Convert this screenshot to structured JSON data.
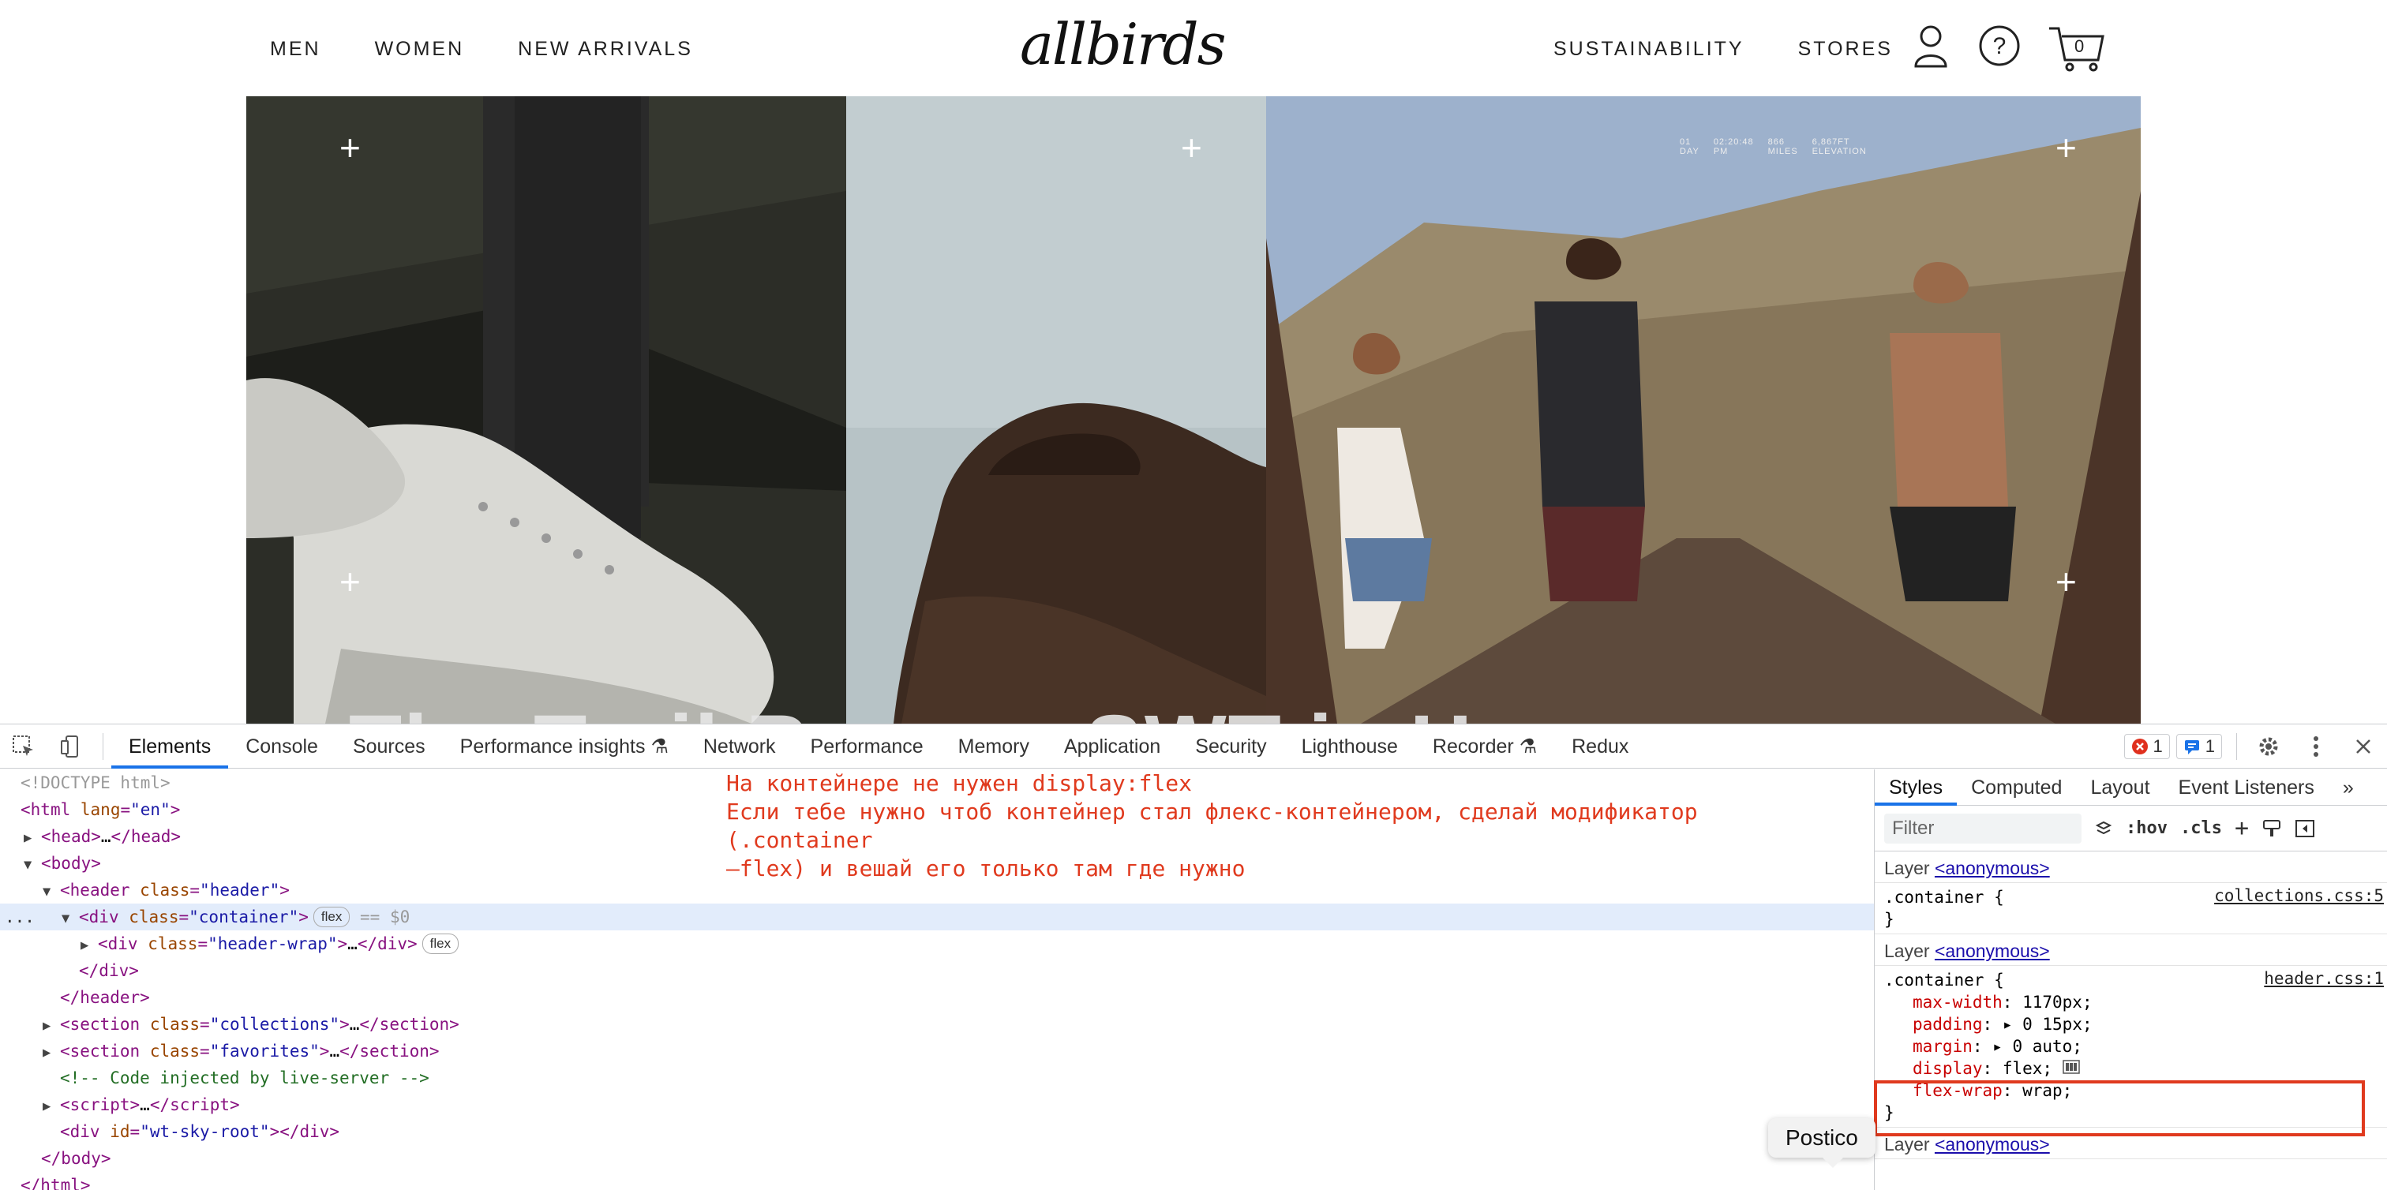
{
  "site": {
    "nav_left": [
      "MEN",
      "WOMEN",
      "NEW ARRIVALS"
    ],
    "logo": "allbirds",
    "nav_right": [
      "SUSTAINABILITY",
      "STORES"
    ],
    "cart_count": "0",
    "hero_stats": [
      "01",
      "DAY",
      "02:20:48",
      "PM",
      "866",
      "MILES",
      "6,867FT",
      "ELEVATION"
    ],
    "hero_partial_text": "The Trail Runner SWT is H"
  },
  "devtools": {
    "tabs": [
      "Elements",
      "Console",
      "Sources",
      "Performance insights ⚗",
      "Network",
      "Performance",
      "Memory",
      "Application",
      "Security",
      "Lighthouse",
      "Recorder ⚗",
      "Redux"
    ],
    "error_count": "1",
    "message_count": "1",
    "elements": {
      "doctype": "<!DOCTYPE html>",
      "html_tag": "html",
      "html_lang": "en",
      "head": "head",
      "body": "body",
      "header": "header",
      "header_class": "header",
      "container": "div",
      "container_class": "container",
      "flex_pill": "flex",
      "selected_marker": "== $0",
      "header_wrap_class": "header-wrap",
      "section1_class": "collections",
      "section2_class": "favorites",
      "comment": "<!-- Code injected by live-server -->",
      "script": "script",
      "sky_root_id": "wt-sky-root",
      "ellipsis": "…",
      "dots": "..."
    },
    "annotation": [
      "На контейнере не нужен display:flex",
      "Если тебе нужно чтоб контейнер стал флекс-контейнером, сделай модификатор (.container",
      "—flex) и вешай его только там где нужно"
    ],
    "styles_tabs": [
      "Styles",
      "Computed",
      "Layout",
      "Event Listeners",
      "»"
    ],
    "filter_placeholder": "Filter",
    "filter_buttons": [
      ":hov",
      ".cls",
      "+"
    ],
    "layer_label": "Layer",
    "layer_link": "<anonymous>",
    "rule1_selector": ".container {",
    "rule1_source": "collections.css:5",
    "rule_close": "}",
    "rule2_selector": ".container {",
    "rule2_source": "header.css:1",
    "rule2_props": [
      {
        "name": "max-width",
        "value": "1170px;"
      },
      {
        "name": "padding",
        "value": "▸ 0 15px;"
      },
      {
        "name": "margin",
        "value": "▸ 0 auto;"
      },
      {
        "name": "display",
        "value": "flex;"
      },
      {
        "name": "flex-wrap",
        "value": "wrap;"
      }
    ],
    "tooltip": "Postico"
  },
  "colors": {
    "accent": "#1a73e8",
    "annotation_red": "#e03a1e",
    "selected_row": "#e2ecfb"
  }
}
